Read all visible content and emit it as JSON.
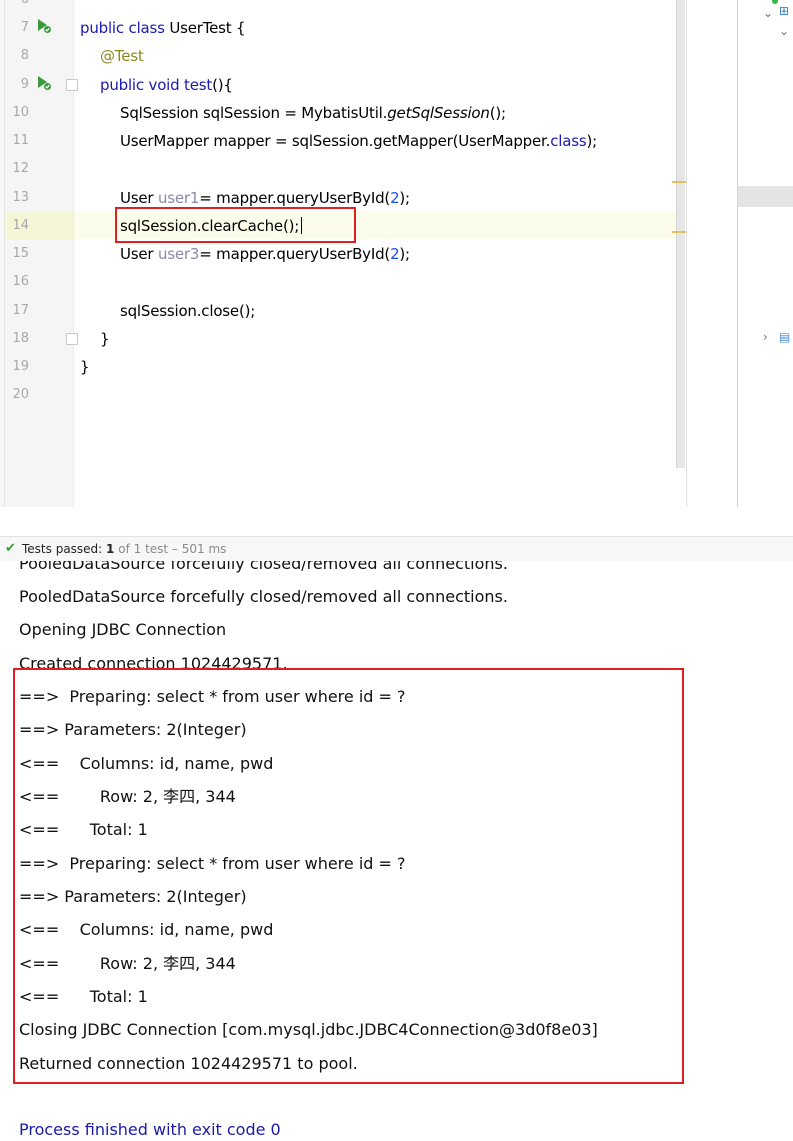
{
  "editor": {
    "line_numbers": [
      "6",
      "7",
      "8",
      "9",
      "10",
      "11",
      "12",
      "13",
      "14",
      "15",
      "16",
      "17",
      "18",
      "19",
      "20"
    ],
    "lines": {
      "l7": {
        "kw1": "public",
        "kw2": "class",
        "rest": " UserTest {"
      },
      "l8": {
        "annotation": "@Test"
      },
      "l9": {
        "kw1": "public",
        "kw2": "void",
        "method": "test",
        "rest": "(){"
      },
      "l10": {
        "a": "SqlSession sqlSession = MybatisUtil.",
        "method": "getSqlSession",
        "b": "();"
      },
      "l11": {
        "a": "UserMapper mapper = sqlSession.getMapper(UserMapper.",
        "kw": "class",
        "b": ");"
      },
      "l13": {
        "a": "User ",
        "var": "user1",
        "b": "= mapper.queryUserById(",
        "num": "2",
        "c": ");"
      },
      "l14": {
        "a": "sqlSession.clearCache();"
      },
      "l15": {
        "a": "User ",
        "var": "user3",
        "b": "= mapper.queryUserById(",
        "num": "2",
        "c": ");"
      },
      "l17": {
        "a": "sqlSession.close();"
      },
      "l18": {
        "a": "}"
      },
      "l19": {
        "a": "}"
      }
    },
    "icons": [
      "run-test-icon",
      "fold-marker-icon"
    ]
  },
  "tests": {
    "status": "Tests passed:",
    "passed": "1",
    "meta": "of 1 test – 501 ms"
  },
  "console": {
    "lines": [
      "PooledDataSource forcefully closed/removed all connections.",
      "PooledDataSource forcefully closed/removed all connections.",
      "Opening JDBC Connection",
      "Created connection 1024429571.",
      "==>  Preparing: select * from user where id = ?",
      "==> Parameters: 2(Integer)",
      "<==    Columns: id, name, pwd",
      "<==        Row: 2, 李四, 344",
      "<==      Total: 1",
      "==>  Preparing: select * from user where id = ?",
      "==> Parameters: 2(Integer)",
      "<==    Columns: id, name, pwd",
      "<==        Row: 2, 李四, 344",
      "<==      Total: 1",
      "Closing JDBC Connection [com.mysql.jdbc.JDBC4Connection@3d0f8e03]",
      "Returned connection 1024429571 to pool.",
      "",
      "Process finished with exit code 0"
    ]
  },
  "colors": {
    "highlight_box": "#e02020",
    "keyword": "#1a1ab0",
    "annotation": "#8a8a20",
    "number": "#1750eb",
    "pass_green": "#3c9a3c"
  }
}
